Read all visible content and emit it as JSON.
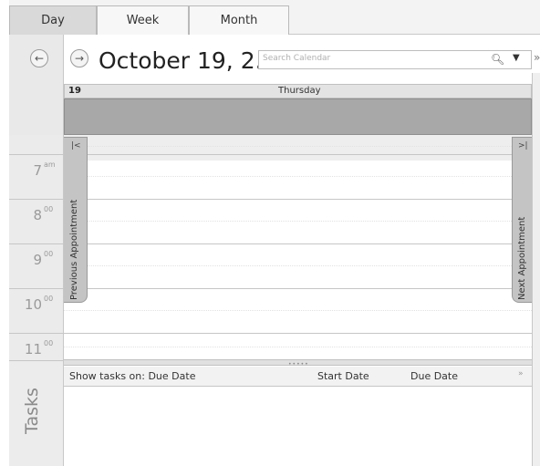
{
  "tabs": [
    {
      "label": "Day",
      "active": true
    },
    {
      "label": "Week",
      "active": false
    },
    {
      "label": "Month",
      "active": false
    }
  ],
  "header": {
    "date_title": "October 19, 2...",
    "back_icon": "back-arrow-icon",
    "forward_icon": "forward-arrow-icon"
  },
  "search": {
    "placeholder": "Search Calendar",
    "icon": "search-icon"
  },
  "day": {
    "number": "19",
    "name": "Thursday"
  },
  "times": [
    {
      "hour": "7",
      "min": "am"
    },
    {
      "hour": "8",
      "min": "00"
    },
    {
      "hour": "9",
      "min": "00"
    },
    {
      "hour": "10",
      "min": "00"
    },
    {
      "hour": "11",
      "min": "00"
    }
  ],
  "appointment_nav": {
    "previous_label": "Previous Appointment",
    "next_label": "Next Appointment"
  },
  "tasks": {
    "panel_label": "Tasks",
    "show_tasks_label": "Show tasks on: Due Date",
    "start_date_col": "Start Date",
    "due_date_col": "Due Date"
  },
  "colors": {
    "allday_bar": "#a8a8a8",
    "tab_active": "#d9d9d9"
  }
}
